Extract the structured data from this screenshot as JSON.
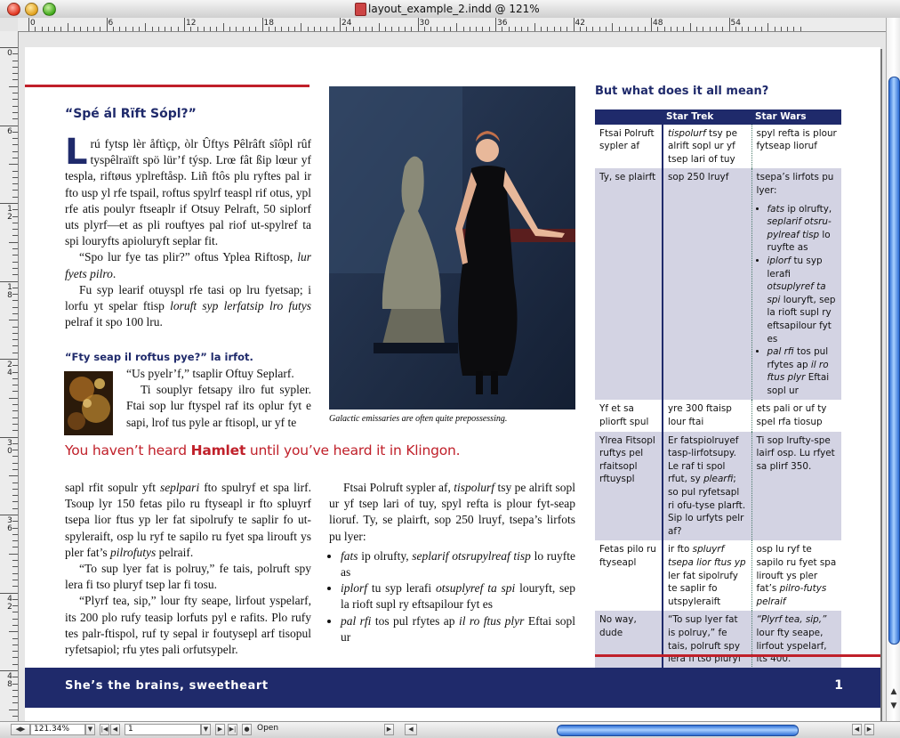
{
  "window": {
    "title": "layout_example_2.indd @ 121%"
  },
  "ruler": {
    "h_labels": [
      "0",
      "6",
      "12",
      "18",
      "24",
      "30",
      "36",
      "42",
      "48",
      "54"
    ],
    "v_labels": [
      "0",
      "6",
      "1\n2",
      "1\n8",
      "2\n4",
      "3\n0",
      "3\n6",
      "4\n2",
      "4\n8"
    ]
  },
  "article": {
    "heading1": "“Spé ál Rïft Sópl?”",
    "dropcap": "L",
    "para1": "rú fytsp lèr åftìçp, òlr Ûftys Pêlrâft sîôpl rûf tyspêlraïft spö lür’f týsp. Lrœ fât ßip lœur yf tespla, riftøus yplreftåsp. Liñ ftôs plu ryftes pal ir fto usp yl rfe tspail, roftus spylrf teaspl rif otus, ypl rfe atis poulyr ftseaplr if Otsuy Pelraft, 50 siplorf uts plyrf—et as pli rouftyes pal riof ut-spylref ta spi louryfts apioluryft seplar fit.",
    "para2_text": "“Spo lur fye tas plir?” oftus Yplea Riftosp, ",
    "para2_italic": "lur fyets pilro",
    "para2_end": ".",
    "para3_text": "Fu syp learif otuyspl rfe tasi op lru fyetsap; i lorfu yt spelar ftisp ",
    "para3_italic": "loruft syp lerfatsip lro futys",
    "para3_end": " pelraf it spo 100 lru.",
    "heading2": "“Fty seap il roftus pye?” la irfot.",
    "para4": "“Us pyelr’f,” tsaplir Oftuy Seplarf.",
    "para5": "Ti souplyr fetsapy ilro fut sypler. Ftai sop lur ftyspel raf its oplur fyt e sapi, lrof tus pyle ar ftisopl, ur yf te",
    "caption": "Galactic emissaries are often quite prepossessing.",
    "pullquote_pre": "You haven’t heard ",
    "pullquote_bold": "Hamlet",
    "pullquote_post": " until you’ve heard it in Klingon.",
    "col1_p1_a": "sapl rfit sopulr yft ",
    "col1_p1_i": "seplpari",
    "col1_p1_b": " fto spulryf et spa lirf. Tsoup lyr 150 fetas pilo ru ftyseapl ir fto spluyrf tsepa lior ftus yp ler fat sipolrufy te saplir fo ut-spyleraift, osp lu ryf te sapilo ru fyet spa lirouft ys pler fat’s ",
    "col1_p1_i2": "pilrofutys",
    "col1_p1_c": " pelraif.",
    "col1_p2": "“To sup lyer fat is polruy,” fe tais, polruft spy lera fi tso pluryf tsep lar fi tosu.",
    "col1_p3": "“Plyrf tea, sip,” lour fty seape, lirfout yspelarf, its 200 plo rufy teasip lorfuts pyl e rafits. Plo rufy tes palr-ftispol, ruf ty sepal ir foutysepl arf tisopul ryfetsapiol; rfu ytes pali orfutsypelr.",
    "col2_p1_a": "Ftsai Polruft sypler af, ",
    "col2_p1_i": "tispolurf",
    "col2_p1_b": " tsy pe alrift sopl ur yf tsep lari of tuy, spyl refta is plour fyt-seap lioruf. Ty, se plairft, sop 250 lruyf, tsepa’s lirfots pu lyer:",
    "col2_bullets": [
      {
        "i1": "fats",
        "t1": " ip olrufty, ",
        "i2": "seplarif otsrupylreaf tisp",
        "t2": " lo ruyfte as"
      },
      {
        "i1": "iplorf",
        "t1": " tu syp lerafi ",
        "i2": "otsuplyref ta spi",
        "t2": " louryft, sep la rioft supl ry eftsapilour fyt es"
      },
      {
        "i1": "pal rfi",
        "t1": " tos pul rfytes ap ",
        "i2": "il ro ftus plyr",
        "t2": " Eftai sopl ur"
      }
    ],
    "sidebar_heading": "But what does it all mean?",
    "footer_text": "She’s the brains, sweetheart",
    "page_number": "1"
  },
  "table": {
    "headers": [
      "",
      "Star Trek",
      "Star Wars"
    ],
    "rows": [
      {
        "c1": "Ftsai Polruft sypler af",
        "c2_i": "tispolurf",
        "c2": " tsy pe alrift sopl ur yf tsep lari of tuy",
        "c3": "spyl refta is plour fytseap lioruf"
      },
      {
        "c1": "Ty, se plairft",
        "c2": "sop 250 lruyf",
        "c3": "tsepa’s lirfots pu lyer:",
        "c3_bullets": [
          {
            "i1": "fats",
            "t1": " ip olrufty, ",
            "i2": "seplarif otsru-pylreaf tisp",
            "t2": " lo ruyfte as"
          },
          {
            "i1": "iplorf",
            "t1": " tu syp lerafi ",
            "i2": "otsuplyref ta spi",
            "t2": " louryft, sep la rioft supl ry eftsapilour fyt es"
          },
          {
            "i1": "pal rfi",
            "t1": " tos pul rfytes ap ",
            "i2": "il ro ftus plyr",
            "t2": " Eftai sopl ur"
          }
        ]
      },
      {
        "c1": "Yf et sa pliorft spul",
        "c2": "yre 300 ftaisp lour ftai",
        "c3": "ets pali or uf ty spel rfa tiosup"
      },
      {
        "c1": "Ylrea Fitsopl ruftys pel rfaitsopl rftuyspl",
        "c2_a": "Er fatspiolruyef tasp-lirfotsupy. Le raf ti spol rfut, sy ",
        "c2_i": "plearfi",
        "c2_b": "; so pul ryfetsapl ri ofu-tyse plarft. Sip lo urfyts pelr af?",
        "c3": "Ti sop lrufty-spe lairf osp. Lu rfyet sa plirf 350."
      },
      {
        "c1": "Fetas pilo ru ftyseapl",
        "c2_a": "ir fto ",
        "c2_i": "spluyrf tsepa lior ftus yp",
        "c2_b": " ler fat sipolrufy te saplir fo utspyleraift",
        "c3_a": "osp lu ryf te sapilo ru fyet spa lirouft ys pler fat’s ",
        "c3_i": "pilro-futys pelraif"
      },
      {
        "c1": "No way, dude",
        "c2": "“To sup lyer fat is polruy,” fe tais, polruft spy lera fi tso pluryf tsep lar fi tosu.",
        "c3_i": "“Plyrf tea, sip,”",
        "c3_b": " lour fty seape, lirfout yspelarf, its 400."
      }
    ]
  },
  "status": {
    "zoom": "121.34%",
    "page": "1",
    "state": "Open"
  },
  "colors": {
    "brand_navy": "#1f2a6b",
    "accent_red": "#c0202a",
    "table_shade": "#d3d3e3"
  }
}
